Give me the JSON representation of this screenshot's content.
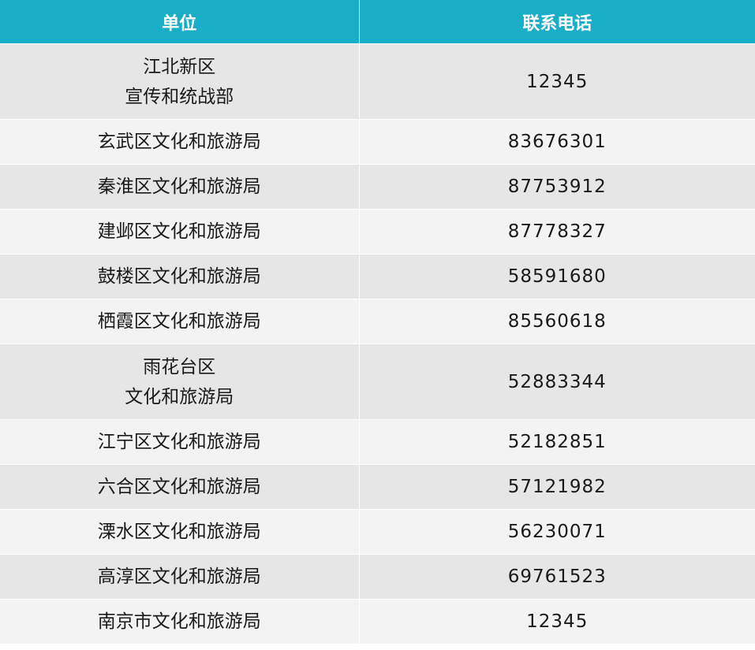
{
  "table": {
    "headers": [
      "单位",
      "联系电话"
    ],
    "rows": [
      {
        "unit": [
          "江北新区",
          "宣传和统战部"
        ],
        "phone": "12345"
      },
      {
        "unit": [
          "玄武区文化和旅游局"
        ],
        "phone": "83676301"
      },
      {
        "unit": [
          "秦淮区文化和旅游局"
        ],
        "phone": "87753912"
      },
      {
        "unit": [
          "建邺区文化和旅游局"
        ],
        "phone": "87778327"
      },
      {
        "unit": [
          "鼓楼区文化和旅游局"
        ],
        "phone": "58591680"
      },
      {
        "unit": [
          "栖霞区文化和旅游局"
        ],
        "phone": "85560618"
      },
      {
        "unit": [
          "雨花台区",
          "文化和旅游局"
        ],
        "phone": "52883344"
      },
      {
        "unit": [
          "江宁区文化和旅游局"
        ],
        "phone": "52182851"
      },
      {
        "unit": [
          "六合区文化和旅游局"
        ],
        "phone": "57121982"
      },
      {
        "unit": [
          "溧水区文化和旅游局"
        ],
        "phone": "56230071"
      },
      {
        "unit": [
          "高淳区文化和旅游局"
        ],
        "phone": "69761523"
      },
      {
        "unit": [
          "南京市文化和旅游局"
        ],
        "phone": "12345"
      }
    ]
  },
  "colors": {
    "header_bg": "#1aadc8",
    "row_odd": "#e6e6e6",
    "row_even": "#f3f3f3"
  }
}
